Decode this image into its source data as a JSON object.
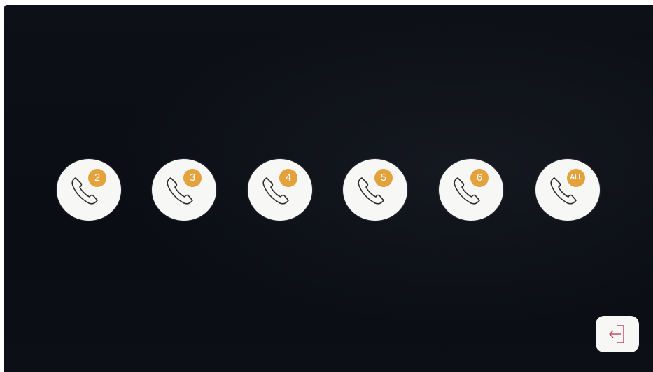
{
  "screen": {
    "background_color": "#0b0e15"
  },
  "call_buttons": [
    {
      "badge": "2",
      "icon": "phone-handset-icon"
    },
    {
      "badge": "3",
      "icon": "phone-handset-icon"
    },
    {
      "badge": "4",
      "icon": "phone-handset-icon"
    },
    {
      "badge": "5",
      "icon": "phone-handset-icon"
    },
    {
      "badge": "6",
      "icon": "phone-handset-icon"
    },
    {
      "badge": "ALL",
      "icon": "phone-handset-icon"
    }
  ],
  "colors": {
    "badge": "#e4a23c",
    "button_face": "#f7f7f5",
    "exit_icon": "#c0455a"
  },
  "exit_button": {
    "icon": "exit-arrow-icon"
  }
}
